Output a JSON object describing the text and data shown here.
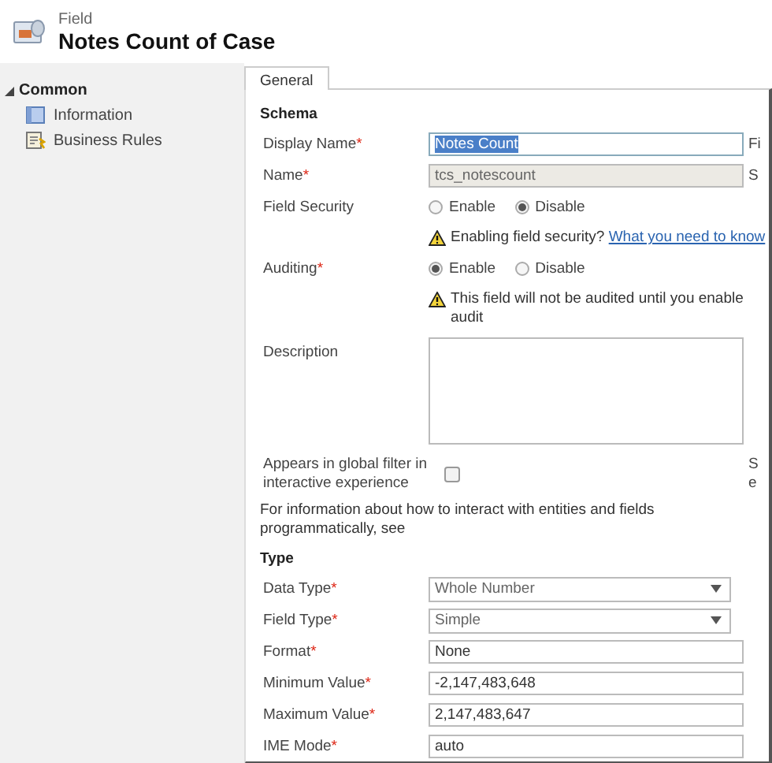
{
  "header": {
    "caption": "Field",
    "title": "Notes Count of Case"
  },
  "sidebar": {
    "section": {
      "label": "Common",
      "expanded": true
    },
    "items": [
      {
        "label": "Information",
        "selected": false
      },
      {
        "label": "Business Rules",
        "selected": false
      }
    ]
  },
  "tabs": [
    {
      "label": "General",
      "selected": true
    }
  ],
  "sections": [
    {
      "heading": "Schema",
      "rows": [
        {
          "kind": "input",
          "label": "Display Name",
          "required_mark": "*",
          "value": "Notes Count",
          "highlighted": true,
          "disabled": false,
          "side": [
            "Fi"
          ]
        },
        {
          "kind": "input",
          "label": "Name",
          "required_mark": "*",
          "value": "tcs_notescount",
          "highlighted": false,
          "disabled": true,
          "side": [
            "S"
          ]
        },
        {
          "kind": "radio",
          "label": "Field Security",
          "options": [
            {
              "label": "Enable",
              "selected": false
            },
            {
              "label": "Disable",
              "selected": true
            }
          ]
        },
        {
          "kind": "warning",
          "text": "Enabling field security?",
          "link": "What you need to know"
        },
        {
          "kind": "radio",
          "label": "Auditing",
          "required_mark": "*",
          "options": [
            {
              "label": "Enable",
              "selected": true
            },
            {
              "label": "Disable",
              "selected": false
            }
          ]
        },
        {
          "kind": "warning",
          "text": "This field will not be audited until you enable audit"
        },
        {
          "kind": "textarea",
          "label": "Description"
        },
        {
          "kind": "checkbox",
          "label": "Appears in global filter in interactive experience",
          "checked": false,
          "side": [
            "S",
            "e"
          ]
        },
        {
          "kind": "note",
          "text": "For information about how to interact with entities and fields programmatically, see"
        }
      ]
    },
    {
      "heading": "Type",
      "rows": [
        {
          "kind": "select",
          "label": "Data Type",
          "required_mark": "*",
          "value": "Whole Number"
        },
        {
          "kind": "select",
          "label": "Field Type",
          "required_mark": "*",
          "value": "Simple"
        },
        {
          "kind": "input",
          "label": "Format",
          "required_mark": "*",
          "value": "None",
          "highlighted": false,
          "disabled": false
        },
        {
          "kind": "input",
          "label": "Minimum Value",
          "required_mark": "*",
          "value": "-2,147,483,648",
          "highlighted": false,
          "disabled": false
        },
        {
          "kind": "input",
          "label": "Maximum Value",
          "required_mark": "*",
          "value": "2,147,483,647",
          "highlighted": false,
          "disabled": false
        },
        {
          "kind": "input",
          "label": "IME Mode",
          "required_mark": "*",
          "value": "auto",
          "highlighted": false,
          "disabled": false
        }
      ]
    }
  ]
}
